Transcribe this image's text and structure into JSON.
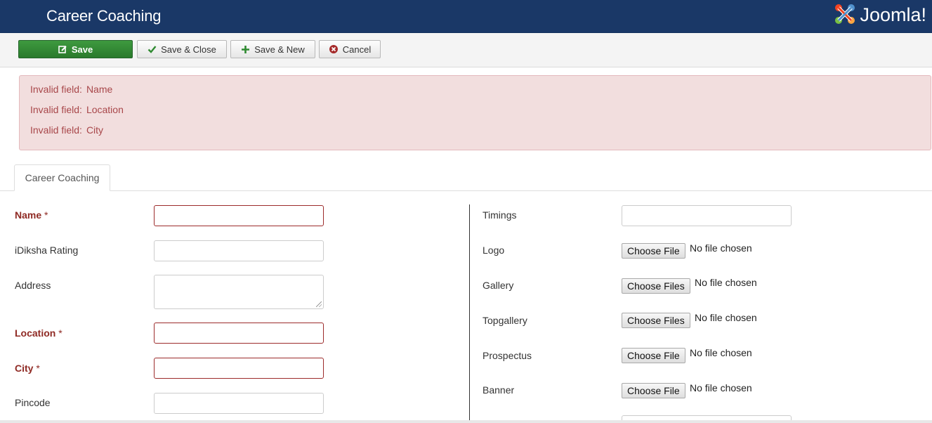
{
  "header": {
    "title": "Career Coaching",
    "brand": "Joomla!"
  },
  "toolbar": {
    "save": "Save",
    "save_close": "Save & Close",
    "save_new": "Save & New",
    "cancel": "Cancel"
  },
  "alert": {
    "prefix": "Invalid field:",
    "fields": [
      "Name",
      "Location",
      "City"
    ]
  },
  "tabs": [
    {
      "label": "Career Coaching"
    }
  ],
  "form_left": {
    "name": {
      "label": "Name",
      "required_mark": "*"
    },
    "rating": {
      "label": "iDiksha Rating"
    },
    "address": {
      "label": "Address"
    },
    "location": {
      "label": "Location",
      "required_mark": "*"
    },
    "city": {
      "label": "City",
      "required_mark": "*"
    },
    "pincode": {
      "label": "Pincode"
    }
  },
  "form_right": {
    "timings": {
      "label": "Timings"
    },
    "logo": {
      "label": "Logo",
      "button": "Choose File",
      "status": "No file chosen"
    },
    "gallery": {
      "label": "Gallery",
      "button": "Choose Files",
      "status": "No file chosen"
    },
    "topgallery": {
      "label": "Topgallery",
      "button": "Choose Files",
      "status": "No file chosen"
    },
    "prospectus": {
      "label": "Prospectus",
      "button": "Choose File",
      "status": "No file chosen"
    },
    "banner": {
      "label": "Banner",
      "button": "Choose File",
      "status": "No file chosen"
    }
  },
  "colors": {
    "header_bg": "#1a3867",
    "save_green": "#2f8a31",
    "alert_bg": "#f2dede",
    "alert_text": "#a8474a",
    "required_label": "#8f2a24"
  }
}
